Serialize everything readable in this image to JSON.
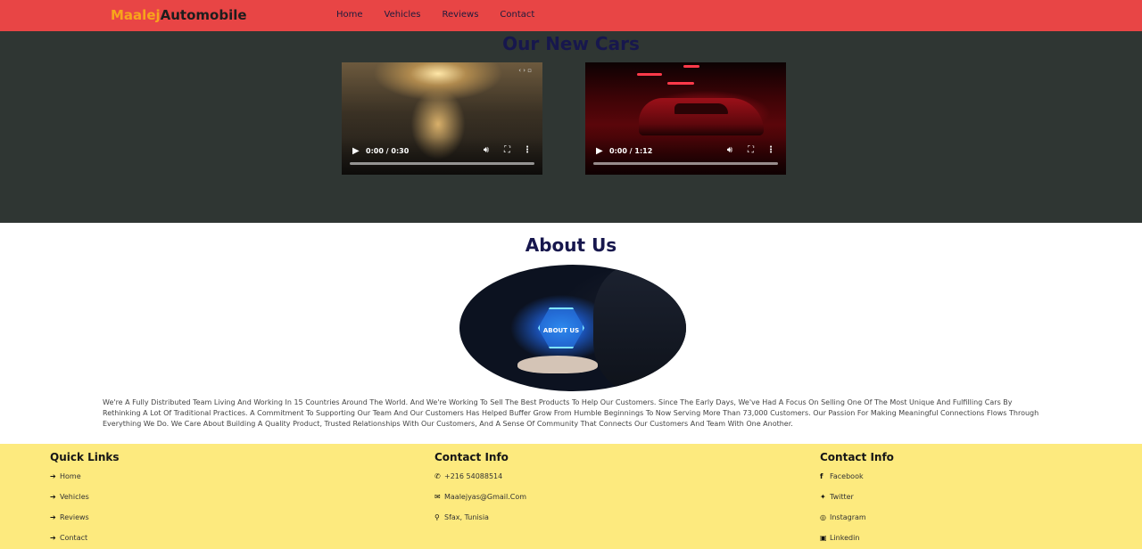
{
  "header": {
    "logo_part1": "Maalej",
    "logo_part2": "Automobile",
    "nav": [
      "Home",
      "Vehicles",
      "Reviews",
      "Contact"
    ]
  },
  "cars_section": {
    "title": "Our New Cars",
    "videos": [
      {
        "time": "0:00 / 0:30"
      },
      {
        "time": "0:00 / 1:12"
      }
    ]
  },
  "about": {
    "title": "About Us",
    "image_label": "ABOUT US",
    "text": "We're A Fully Distributed Team Living And Working In 15 Countries Around The World. And We're Working To Sell The Best Products To Help Our Customers. Since The Early Days, We've Had A Focus On Selling One Of The Most Unique And Fulfilling Cars By Rethinking A Lot Of Traditional Practices. A Commitment To Supporting Our Team And Our Customers Has Helped Buffer Grow From Humble Beginnings To Now Serving More Than 73,000 Customers. Our Passion For Making Meaningful Connections Flows Through Everything We Do. We Care About Building A Quality Product, Trusted Relationships With Our Customers, And A Sense Of Community That Connects Our Customers And Team With One Another."
  },
  "footer": {
    "quick_links": {
      "title": "Quick Links",
      "items": [
        {
          "icon": "arrow-right-icon",
          "label": "Home"
        },
        {
          "icon": "arrow-right-icon",
          "label": "Vehicles"
        },
        {
          "icon": "arrow-right-icon",
          "label": "Reviews"
        },
        {
          "icon": "arrow-right-icon",
          "label": "Contact"
        }
      ]
    },
    "contact_info": {
      "title": "Contact Info",
      "items": [
        {
          "icon": "phone-icon",
          "label": "+216 54088514"
        },
        {
          "icon": "envelope-icon",
          "label": "Maalejyas@Gmail.Com"
        },
        {
          "icon": "map-marker-icon",
          "label": "Sfax, Tunisia"
        }
      ]
    },
    "social": {
      "title": "Contact Info",
      "items": [
        {
          "icon": "facebook-icon",
          "label": "Facebook"
        },
        {
          "icon": "twitter-icon",
          "label": "Twitter"
        },
        {
          "icon": "instagram-icon",
          "label": "Instagram"
        },
        {
          "icon": "linkedin-icon",
          "label": "Linkedin"
        }
      ]
    }
  },
  "colors": {
    "header_bg": "#e84545",
    "logo_accent": "#f8a51b",
    "cars_bg": "#2f3633",
    "heading": "#17174d",
    "footer_bg": "#fdea7e"
  }
}
